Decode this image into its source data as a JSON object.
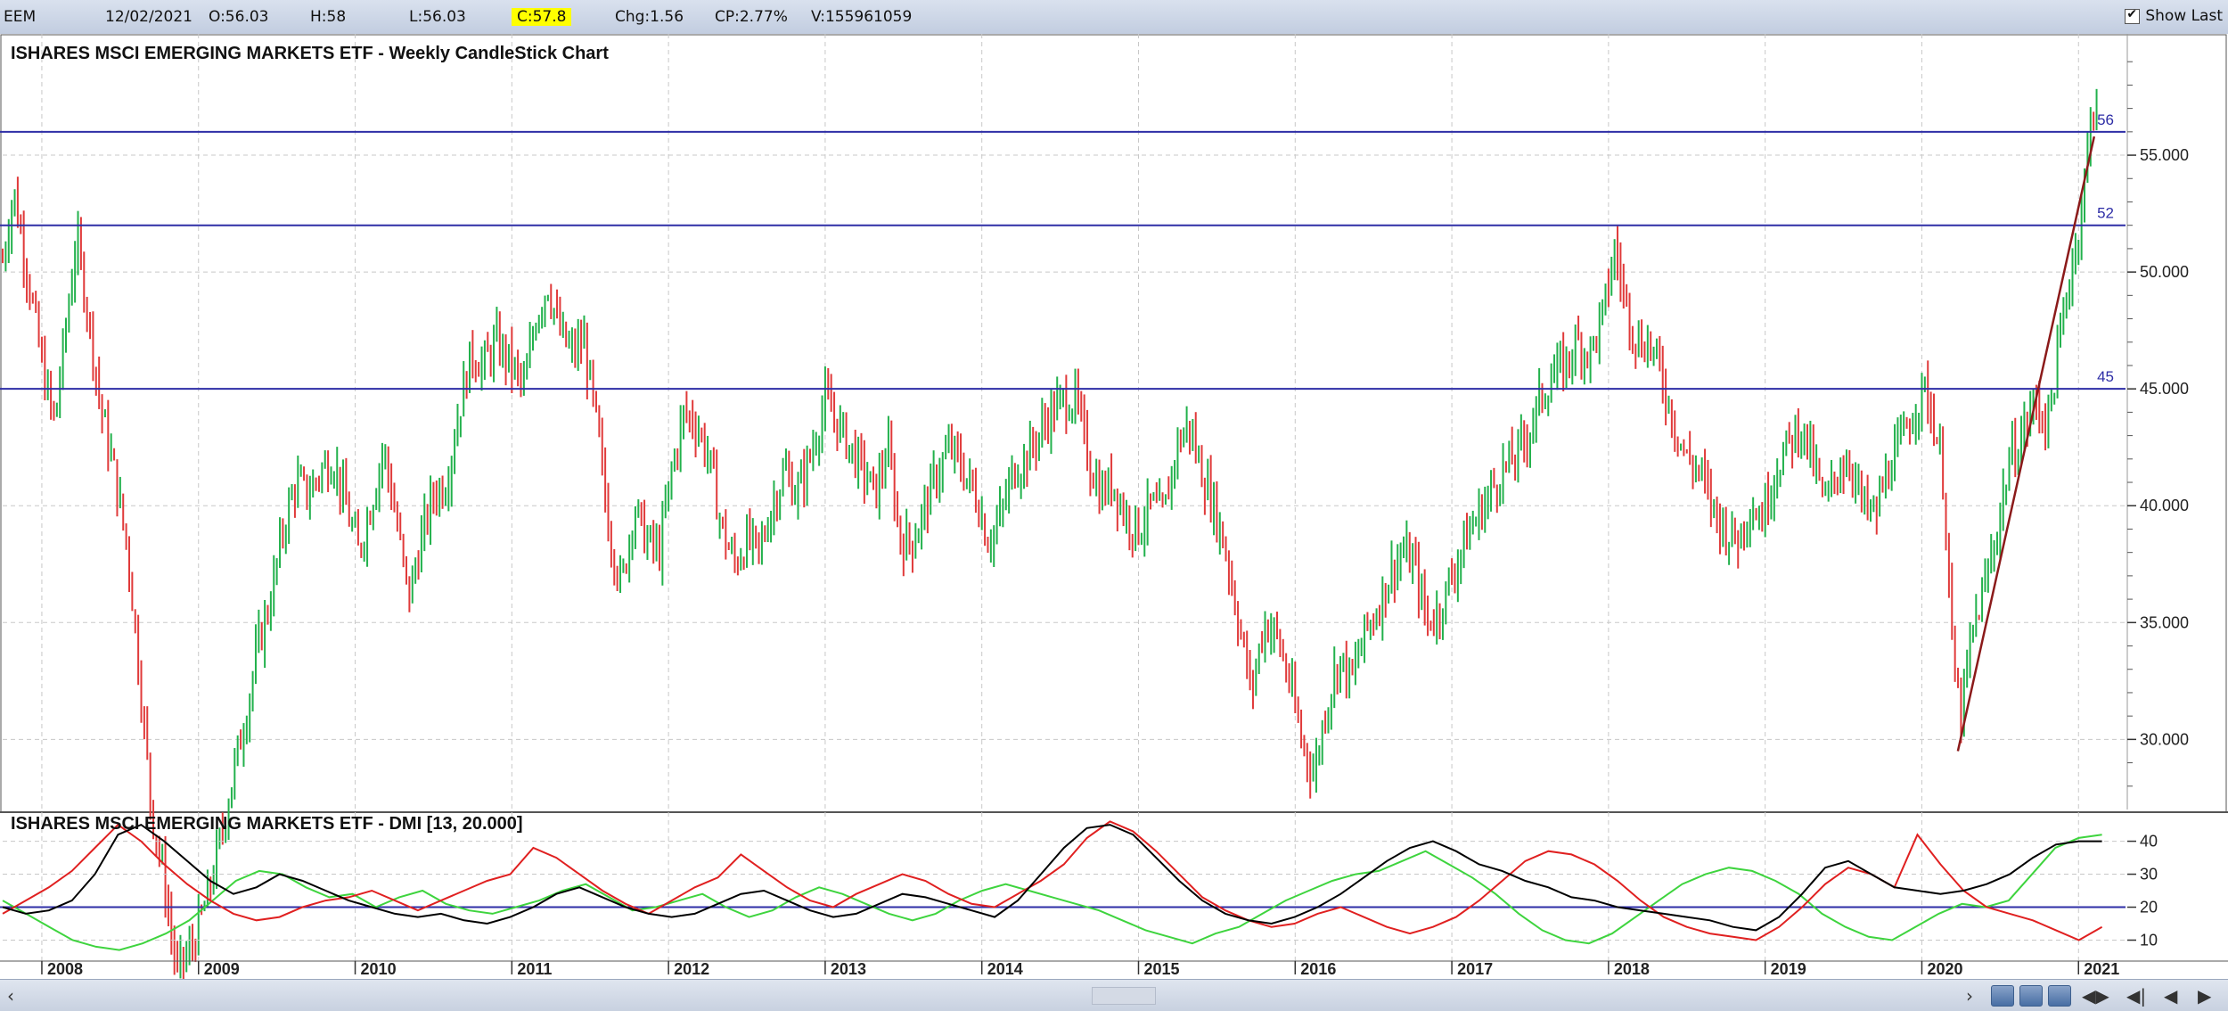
{
  "toolbar": {
    "symbol": "EEM",
    "date": "12/02/2021",
    "open": "O:56.03",
    "high": "H:58",
    "low": "L:56.03",
    "close": "C:57.8",
    "change": "Chg:1.56",
    "change_pct": "CP:2.77%",
    "volume": "V:155961059",
    "show_last_label": "Show Last",
    "show_last_checked": true
  },
  "colors": {
    "up": "#22b14c",
    "down": "#e03a3a",
    "hline": "#2e2ea6",
    "trendline": "#8b1a1a",
    "grid": "#c8c8c8",
    "plus_di": "#3ed43e",
    "minus_di": "#e02020",
    "adx": "#000000",
    "highlight": "#ffff00"
  },
  "chart_data": [
    {
      "type": "candlestick",
      "title": "ISHARES MSCI EMERGING MARKETS ETF - Weekly CandleStick Chart",
      "x_range": [
        2007.75,
        2021.3
      ],
      "ylim": [
        27,
        60
      ],
      "y_ticks": [
        "30.000",
        "35.000",
        "40.000",
        "45.000",
        "50.000",
        "55.000"
      ],
      "x_ticks": [
        "2008",
        "2009",
        "2010",
        "2011",
        "2012",
        "2013",
        "2014",
        "2015",
        "2016",
        "2017",
        "2018",
        "2019",
        "2020",
        "2021"
      ],
      "grid": true,
      "horizontal_lines": [
        {
          "label": "56",
          "value": 56
        },
        {
          "label": "52",
          "value": 52
        },
        {
          "label": "45",
          "value": 45
        }
      ],
      "trendline": {
        "from": [
          2020.23,
          29.5
        ],
        "to": [
          2021.1,
          55.8
        ]
      },
      "price_path": [
        [
          2007.75,
          50.5
        ],
        [
          2007.82,
          53.5
        ],
        [
          2007.92,
          49.5
        ],
        [
          2008.0,
          46
        ],
        [
          2008.08,
          43.5
        ],
        [
          2008.16,
          48
        ],
        [
          2008.22,
          51.5
        ],
        [
          2008.3,
          48
        ],
        [
          2008.38,
          44
        ],
        [
          2008.46,
          41.5
        ],
        [
          2008.55,
          38
        ],
        [
          2008.62,
          33
        ],
        [
          2008.7,
          27
        ],
        [
          2008.78,
          24
        ],
        [
          2008.86,
          20
        ],
        [
          2008.95,
          21
        ],
        [
          2009.05,
          23
        ],
        [
          2009.15,
          26
        ],
        [
          2009.22,
          28.5
        ],
        [
          2009.3,
          31
        ],
        [
          2009.38,
          34
        ],
        [
          2009.46,
          36
        ],
        [
          2009.54,
          39
        ],
        [
          2009.62,
          41
        ],
        [
          2009.7,
          40.5
        ],
        [
          2009.78,
          41.5
        ],
        [
          2009.86,
          42
        ],
        [
          2009.94,
          40
        ],
        [
          2010.02,
          38
        ],
        [
          2010.1,
          40
        ],
        [
          2010.18,
          42.5
        ],
        [
          2010.26,
          39.5
        ],
        [
          2010.34,
          36
        ],
        [
          2010.42,
          38.5
        ],
        [
          2010.5,
          40.5
        ],
        [
          2010.58,
          41
        ],
        [
          2010.66,
          44
        ],
        [
          2010.74,
          46.5
        ],
        [
          2010.82,
          46
        ],
        [
          2010.9,
          47
        ],
        [
          2011.0,
          46
        ],
        [
          2011.08,
          45
        ],
        [
          2011.15,
          48
        ],
        [
          2011.23,
          49.5
        ],
        [
          2011.3,
          47.5
        ],
        [
          2011.38,
          46.5
        ],
        [
          2011.46,
          47
        ],
        [
          2011.55,
          43
        ],
        [
          2011.62,
          39
        ],
        [
          2011.7,
          36.5
        ],
        [
          2011.78,
          40
        ],
        [
          2011.86,
          38.5
        ],
        [
          2011.94,
          38
        ],
        [
          2012.02,
          41.5
        ],
        [
          2012.1,
          44
        ],
        [
          2012.18,
          43.5
        ],
        [
          2012.26,
          42
        ],
        [
          2012.34,
          39
        ],
        [
          2012.42,
          37.5
        ],
        [
          2012.5,
          38.5
        ],
        [
          2012.58,
          38
        ],
        [
          2012.66,
          40
        ],
        [
          2012.74,
          41.5
        ],
        [
          2012.82,
          40.5
        ],
        [
          2012.9,
          42
        ],
        [
          2013.0,
          44.5
        ],
        [
          2013.08,
          43.5
        ],
        [
          2013.16,
          42.5
        ],
        [
          2013.24,
          41.5
        ],
        [
          2013.32,
          40.5
        ],
        [
          2013.4,
          42.5
        ],
        [
          2013.48,
          38.5
        ],
        [
          2013.56,
          38.5
        ],
        [
          2013.64,
          40
        ],
        [
          2013.72,
          41.5
        ],
        [
          2013.8,
          42.5
        ],
        [
          2013.88,
          41.5
        ],
        [
          2013.96,
          40.5
        ],
        [
          2014.04,
          38.5
        ],
        [
          2014.12,
          39.5
        ],
        [
          2014.2,
          41.5
        ],
        [
          2014.28,
          42
        ],
        [
          2014.36,
          43
        ],
        [
          2014.44,
          44
        ],
        [
          2014.52,
          44.5
        ],
        [
          2014.6,
          44.5
        ],
        [
          2014.68,
          42
        ],
        [
          2014.76,
          40.5
        ],
        [
          2014.84,
          41
        ],
        [
          2014.92,
          39.5
        ],
        [
          2015.0,
          39
        ],
        [
          2015.08,
          40
        ],
        [
          2015.16,
          39.5
        ],
        [
          2015.24,
          42.5
        ],
        [
          2015.32,
          43.5
        ],
        [
          2015.4,
          41.5
        ],
        [
          2015.48,
          40
        ],
        [
          2015.56,
          38
        ],
        [
          2015.64,
          35
        ],
        [
          2015.72,
          32
        ],
        [
          2015.8,
          35
        ],
        [
          2015.88,
          34.5
        ],
        [
          2015.96,
          32.5
        ],
        [
          2016.04,
          30
        ],
        [
          2016.12,
          28.5
        ],
        [
          2016.2,
          31.5
        ],
        [
          2016.28,
          33.5
        ],
        [
          2016.36,
          32.5
        ],
        [
          2016.44,
          34.5
        ],
        [
          2016.52,
          35.5
        ],
        [
          2016.6,
          37
        ],
        [
          2016.68,
          38
        ],
        [
          2016.76,
          37.5
        ],
        [
          2016.84,
          35
        ],
        [
          2016.92,
          35.5
        ],
        [
          2017.0,
          37
        ],
        [
          2017.08,
          38.5
        ],
        [
          2017.16,
          39.5
        ],
        [
          2017.24,
          40.5
        ],
        [
          2017.32,
          41.5
        ],
        [
          2017.4,
          42
        ],
        [
          2017.48,
          43
        ],
        [
          2017.56,
          44.5
        ],
        [
          2017.64,
          45.5
        ],
        [
          2017.72,
          46
        ],
        [
          2017.8,
          47
        ],
        [
          2017.88,
          46.5
        ],
        [
          2017.96,
          48
        ],
        [
          2018.04,
          51
        ],
        [
          2018.1,
          49
        ],
        [
          2018.18,
          47
        ],
        [
          2018.26,
          47
        ],
        [
          2018.34,
          45.5
        ],
        [
          2018.42,
          43.5
        ],
        [
          2018.5,
          42
        ],
        [
          2018.58,
          41.5
        ],
        [
          2018.66,
          40
        ],
        [
          2018.74,
          39
        ],
        [
          2018.82,
          38.5
        ],
        [
          2018.9,
          40
        ],
        [
          2018.98,
          39.5
        ],
        [
          2019.06,
          41.5
        ],
        [
          2019.14,
          42.5
        ],
        [
          2019.22,
          43.5
        ],
        [
          2019.3,
          42
        ],
        [
          2019.38,
          40
        ],
        [
          2019.46,
          41.5
        ],
        [
          2019.54,
          42
        ],
        [
          2019.62,
          40
        ],
        [
          2019.7,
          39.5
        ],
        [
          2019.78,
          41.5
        ],
        [
          2019.86,
          42.5
        ],
        [
          2019.94,
          44
        ],
        [
          2020.02,
          45
        ],
        [
          2020.08,
          43.5
        ],
        [
          2020.14,
          41
        ],
        [
          2020.2,
          33
        ],
        [
          2020.25,
          31
        ],
        [
          2020.32,
          34.5
        ],
        [
          2020.4,
          36.5
        ],
        [
          2020.48,
          39
        ],
        [
          2020.56,
          42
        ],
        [
          2020.64,
          43
        ],
        [
          2020.72,
          44.5
        ],
        [
          2020.8,
          43.5
        ],
        [
          2020.86,
          46
        ],
        [
          2020.92,
          49
        ],
        [
          2020.98,
          51
        ],
        [
          2021.04,
          54
        ],
        [
          2021.08,
          56.5
        ],
        [
          2021.11,
          57.8
        ]
      ]
    },
    {
      "type": "line",
      "title": "ISHARES MSCI EMERGING MARKETS ETF - DMI [13, 20.000]",
      "ylim": [
        5,
        48
      ],
      "y_ticks": [
        "10",
        "20",
        "30",
        "40"
      ],
      "reference_line": 20,
      "grid": true,
      "series": [
        {
          "key": "plus_di",
          "values": [
            22,
            18,
            14,
            10,
            8,
            7,
            9,
            12,
            16,
            22,
            28,
            31,
            30,
            26,
            23,
            24,
            20,
            23,
            25,
            21,
            19,
            18,
            20,
            22,
            25,
            27,
            23,
            19,
            20,
            22,
            24,
            20,
            17,
            19,
            23,
            26,
            24,
            21,
            18,
            16,
            18,
            22,
            25,
            27,
            25,
            23,
            21,
            19,
            16,
            13,
            11,
            9,
            12,
            14,
            18,
            22,
            25,
            28,
            30,
            31,
            34,
            37,
            33,
            29,
            24,
            18,
            13,
            10,
            9,
            12,
            17,
            22,
            27,
            30,
            32,
            31,
            28,
            24,
            18,
            14,
            11,
            10,
            14,
            18,
            21,
            20,
            22,
            30,
            38,
            41,
            42
          ]
        },
        {
          "key": "minus_di",
          "values": [
            18,
            22,
            26,
            31,
            38,
            45,
            40,
            33,
            27,
            22,
            18,
            16,
            17,
            20,
            22,
            23,
            25,
            22,
            19,
            22,
            25,
            28,
            30,
            38,
            35,
            30,
            25,
            21,
            18,
            22,
            26,
            29,
            36,
            31,
            26,
            22,
            20,
            24,
            27,
            30,
            28,
            24,
            21,
            20,
            24,
            28,
            33,
            41,
            46,
            43,
            37,
            30,
            23,
            19,
            16,
            14,
            15,
            18,
            20,
            17,
            14,
            12,
            14,
            17,
            22,
            28,
            34,
            37,
            36,
            33,
            28,
            22,
            17,
            14,
            12,
            11,
            10,
            14,
            20,
            27,
            32,
            30,
            26,
            42,
            33,
            25,
            20,
            18,
            16,
            13,
            10,
            14
          ]
        },
        {
          "key": "adx",
          "values": [
            20,
            18,
            19,
            22,
            30,
            42,
            45,
            40,
            34,
            28,
            24,
            26,
            30,
            28,
            25,
            22,
            20,
            18,
            17,
            18,
            16,
            15,
            17,
            20,
            24,
            26,
            23,
            20,
            18,
            17,
            18,
            21,
            24,
            25,
            22,
            19,
            17,
            18,
            21,
            24,
            23,
            21,
            19,
            17,
            22,
            30,
            38,
            44,
            45,
            42,
            35,
            28,
            22,
            18,
            16,
            15,
            17,
            20,
            24,
            29,
            34,
            38,
            40,
            37,
            33,
            31,
            28,
            26,
            23,
            22,
            20,
            19,
            18,
            17,
            16,
            14,
            13,
            17,
            24,
            32,
            34,
            30,
            26,
            25,
            24,
            25,
            27,
            30,
            35,
            39,
            40,
            40
          ]
        }
      ]
    }
  ]
}
